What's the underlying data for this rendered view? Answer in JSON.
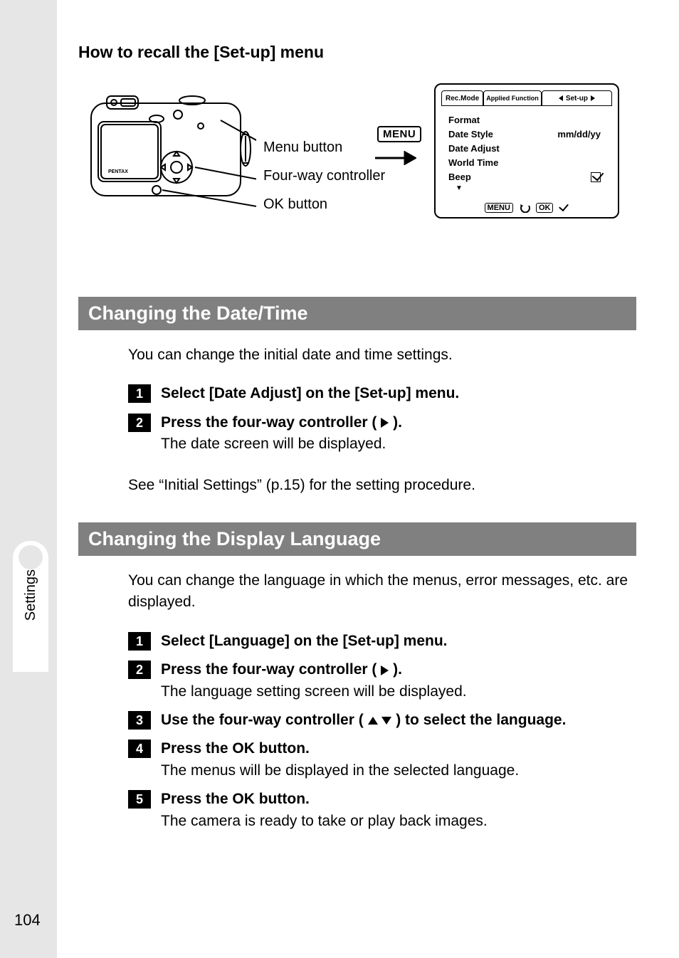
{
  "recall_heading": "How to recall the [Set-up] menu",
  "camera_labels": {
    "menu_button": "Menu button",
    "four_way": "Four-way controller",
    "ok_button": "OK button"
  },
  "menu_badge": "MENU",
  "lcd": {
    "tabs": {
      "rec": "Rec.Mode",
      "applied": "Applied Function",
      "setup": "Set-up"
    },
    "rows": {
      "format": "Format",
      "date_style": "Date Style",
      "date_style_val": "mm/dd/yy",
      "date_adjust": "Date Adjust",
      "world_time": "World Time",
      "beep": "Beep"
    },
    "footer": {
      "menu": "MENU",
      "ok": "OK"
    }
  },
  "sections": {
    "datetime": {
      "title": "Changing the Date/Time",
      "intro": "You can change the initial date and time settings.",
      "steps": [
        {
          "num": "1",
          "title": "Select [Date Adjust] on the [Set-up] menu."
        },
        {
          "num": "2",
          "title_pre": "Press the four-way controller ( ",
          "title_post": " ).",
          "desc": "The date screen will be displayed."
        }
      ],
      "see": "See “Initial Settings” (p.15) for the setting procedure."
    },
    "language": {
      "title": "Changing the Display Language",
      "intro": "You can change the language in which the menus, error messages, etc. are displayed.",
      "steps": [
        {
          "num": "1",
          "title": "Select [Language] on the [Set-up] menu."
        },
        {
          "num": "2",
          "title_pre": "Press the four-way controller ( ",
          "title_post": " ).",
          "desc": "The language setting screen will be displayed."
        },
        {
          "num": "3",
          "title_pre": "Use the four-way controller ( ",
          "title_post": " ) to select the language."
        },
        {
          "num": "4",
          "title": "Press the OK button.",
          "desc": "The menus will be displayed in the selected language."
        },
        {
          "num": "5",
          "title": "Press the OK button.",
          "desc": "The camera is ready to take or play back images."
        }
      ]
    }
  },
  "side_tab": "Settings",
  "page_number": "104"
}
